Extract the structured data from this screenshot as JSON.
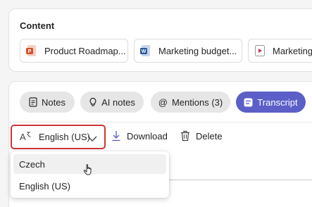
{
  "content": {
    "title": "Content",
    "files": [
      {
        "name": "Product Roadmap...",
        "icon": "powerpoint-file-icon",
        "color": "#d35230"
      },
      {
        "name": "Marketing budget...",
        "icon": "word-file-icon",
        "color": "#2b579a"
      },
      {
        "name": "Marketing",
        "icon": "video-file-icon",
        "color": "#c4314b"
      }
    ]
  },
  "tabs": [
    {
      "label": "Notes",
      "icon": "notes-icon",
      "active": false
    },
    {
      "label": "AI notes",
      "icon": "lightbulb-icon",
      "active": false
    },
    {
      "label": "Mentions (3)",
      "icon": "at-sign-icon",
      "active": false
    },
    {
      "label": "Transcript",
      "icon": "transcript-icon",
      "active": true
    }
  ],
  "toolbar": {
    "language_label": "English (US)",
    "download_label": "Download",
    "delete_label": "Delete"
  },
  "language_menu": {
    "options": [
      "Czech",
      "English (US)"
    ],
    "hovered": "Czech"
  },
  "colors": {
    "accent": "#5b5fc7",
    "highlight_border": "#d13438"
  }
}
